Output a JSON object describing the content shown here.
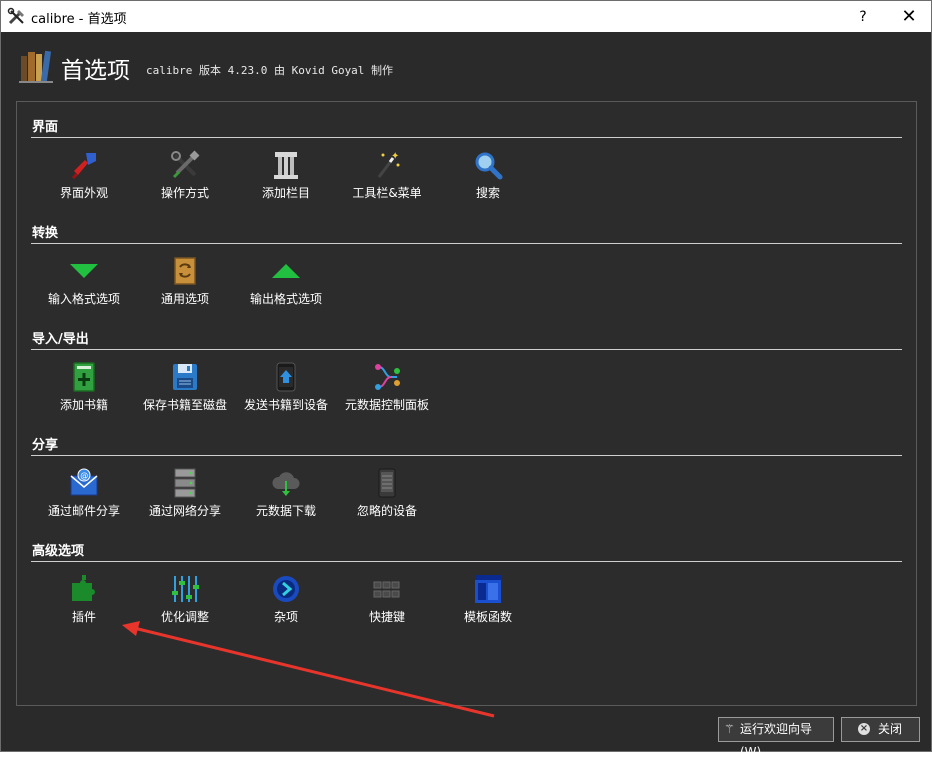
{
  "window": {
    "title": "calibre - 首选项",
    "help_glyph": "?",
    "close_glyph": "✕"
  },
  "header": {
    "title": "首选项",
    "subtitle": "calibre 版本 4.23.0 由 Kovid Goyal 制作"
  },
  "sections": [
    {
      "title": "界面",
      "items": [
        {
          "label": "界面外观",
          "icon": "paintbrush-icon"
        },
        {
          "label": "操作方式",
          "icon": "tools-icon"
        },
        {
          "label": "添加栏目",
          "icon": "column-icon"
        },
        {
          "label": "工具栏&菜单",
          "icon": "wand-icon"
        },
        {
          "label": "搜索",
          "icon": "search-icon"
        }
      ]
    },
    {
      "title": "转换",
      "items": [
        {
          "label": "输入格式选项",
          "icon": "arrow-down-icon"
        },
        {
          "label": "通用选项",
          "icon": "convert-icon"
        },
        {
          "label": "输出格式选项",
          "icon": "arrow-up-icon"
        }
      ]
    },
    {
      "title": "导入/导出",
      "items": [
        {
          "label": "添加书籍",
          "icon": "add-book-icon"
        },
        {
          "label": "保存书籍至磁盘",
          "icon": "save-icon"
        },
        {
          "label": "发送书籍到设备",
          "icon": "send-device-icon"
        },
        {
          "label": "元数据控制面板",
          "icon": "metadata-plugboard-icon"
        }
      ]
    },
    {
      "title": "分享",
      "items": [
        {
          "label": "通过邮件分享",
          "icon": "mail-icon"
        },
        {
          "label": "通过网络分享",
          "icon": "server-icon"
        },
        {
          "label": "元数据下载",
          "icon": "cloud-download-icon"
        },
        {
          "label": "忽略的设备",
          "icon": "ignored-device-icon"
        }
      ]
    },
    {
      "title": "高级选项",
      "items": [
        {
          "label": "插件",
          "icon": "plugin-icon"
        },
        {
          "label": "优化调整",
          "icon": "tweaks-icon"
        },
        {
          "label": "杂项",
          "icon": "misc-icon"
        },
        {
          "label": "快捷键",
          "icon": "keyboard-icon"
        },
        {
          "label": "模板函数",
          "icon": "template-icon"
        }
      ]
    }
  ],
  "footer": {
    "wizard_label": "运行欢迎向导(W)",
    "close_label": "关闭"
  }
}
